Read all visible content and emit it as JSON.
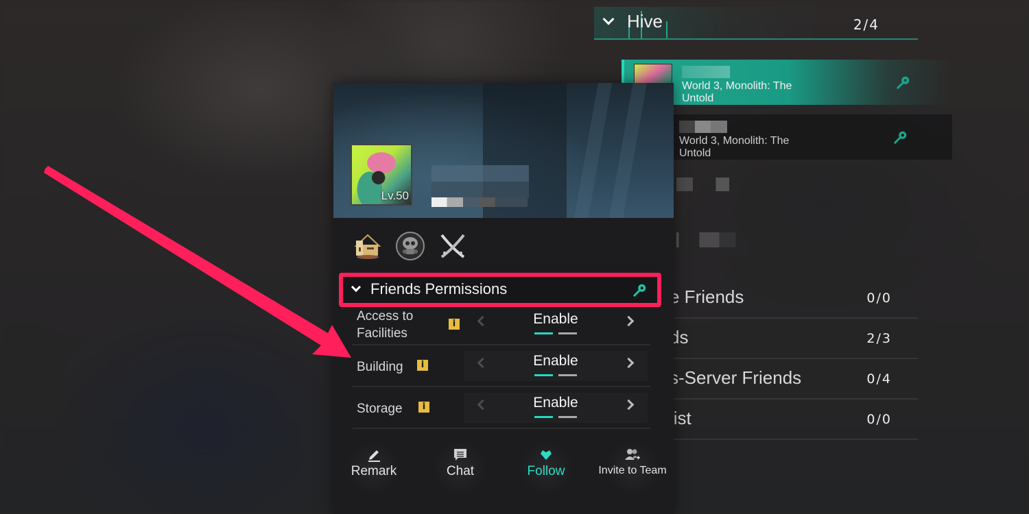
{
  "friend_list": {
    "group": {
      "title": "Hive",
      "count": "2/4",
      "expanded": true
    },
    "friends": [
      {
        "location": "World 3, Monolith: The Untold",
        "active": true,
        "icon": "key-icon"
      },
      {
        "location": "World 3, Monolith: The Untold",
        "active": false,
        "icon": "key-icon"
      }
    ],
    "categories": [
      {
        "label": "e Friends",
        "count": "0/0"
      },
      {
        "label": "ds",
        "count": "2/3"
      },
      {
        "label": "s-Server Friends",
        "count": "0/4"
      },
      {
        "label": "list",
        "count": "0/0"
      }
    ]
  },
  "profile": {
    "level": "Lv.50",
    "badges": [
      "building-badge-icon",
      "gasmask-skull-badge-icon",
      "crossed-blades-badge-icon"
    ],
    "permissions": {
      "title": "Friends Permissions",
      "rows": [
        {
          "label": "Access to Facilities",
          "value": "Enable",
          "page": 1,
          "pages": 2
        },
        {
          "label": "Building",
          "value": "Enable",
          "page": 1,
          "pages": 2
        },
        {
          "label": "Storage",
          "value": "Enable",
          "page": 1,
          "pages": 2
        }
      ]
    },
    "actions": [
      {
        "label": "Remark",
        "icon": "pencil-icon"
      },
      {
        "label": "Chat",
        "icon": "chat-bubble-icon"
      },
      {
        "label": "Follow",
        "icon": "heart-icon"
      },
      {
        "label": "Invite to Team",
        "icon": "invite-team-icon"
      }
    ]
  },
  "colors": {
    "accent": "#24d9c0",
    "highlight_annotation": "#ff1f5a",
    "info_badge": "#e7bd3f"
  }
}
